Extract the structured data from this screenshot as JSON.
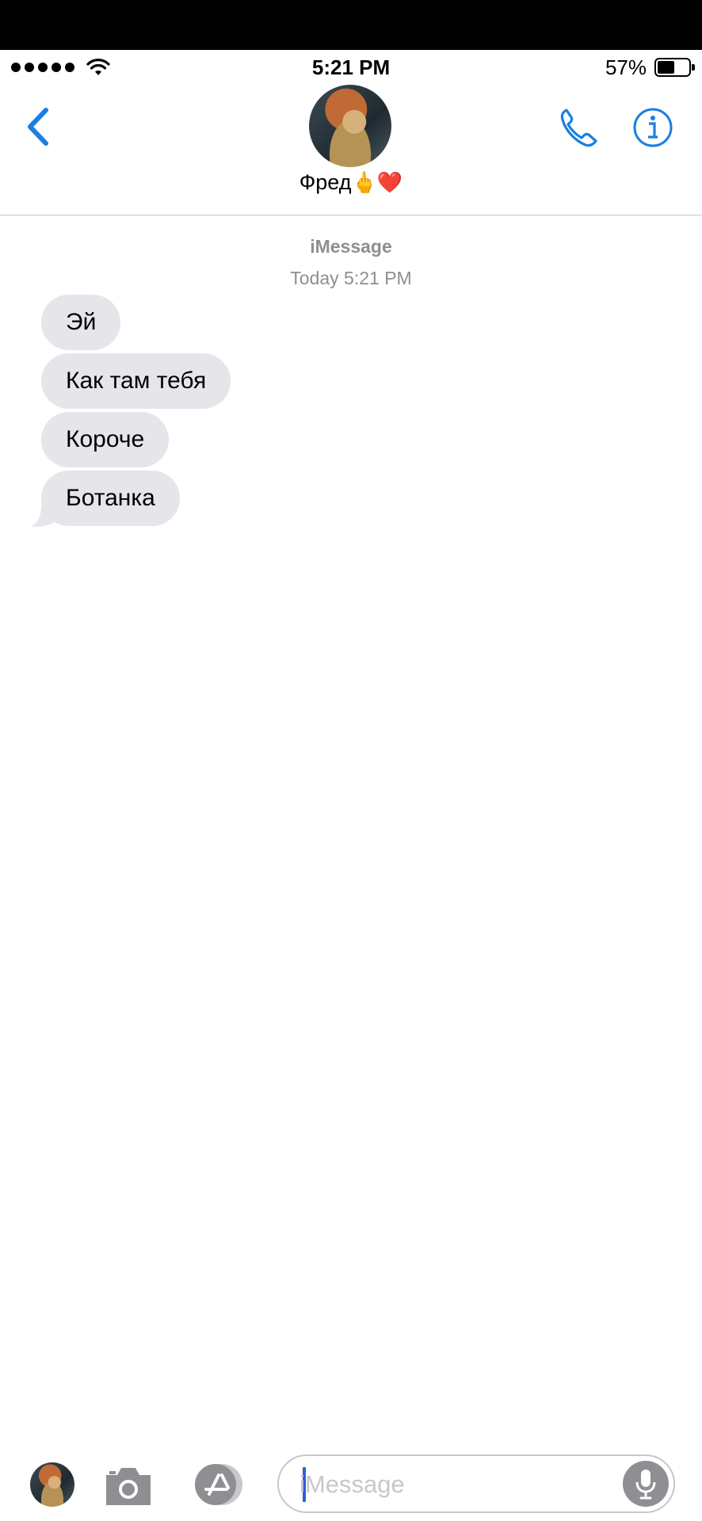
{
  "status_bar": {
    "time": "5:21 PM",
    "battery_percent": "57%",
    "battery_level": 0.57,
    "signal_bars": 5
  },
  "header": {
    "contact_name": "Фред",
    "contact_emoji": "🖕❤️",
    "back_icon": "chevron-left-icon",
    "call_icon": "phone-icon",
    "info_icon": "info-icon"
  },
  "thread": {
    "service": "iMessage",
    "date_label": "Today",
    "time_label": "5:21 PM",
    "messages": [
      {
        "text": "Эй"
      },
      {
        "text": "Как там тебя"
      },
      {
        "text": "Короче"
      },
      {
        "text": "Ботанка"
      }
    ]
  },
  "composer": {
    "placeholder": "iMessage",
    "value": "",
    "camera_icon": "camera-icon",
    "apps_icon": "app-store-icon",
    "mic_icon": "microphone-icon"
  },
  "colors": {
    "accent": "#1a7fe0",
    "bubble_incoming": "#e5e5ea",
    "secondary_text": "#8e8e93"
  }
}
